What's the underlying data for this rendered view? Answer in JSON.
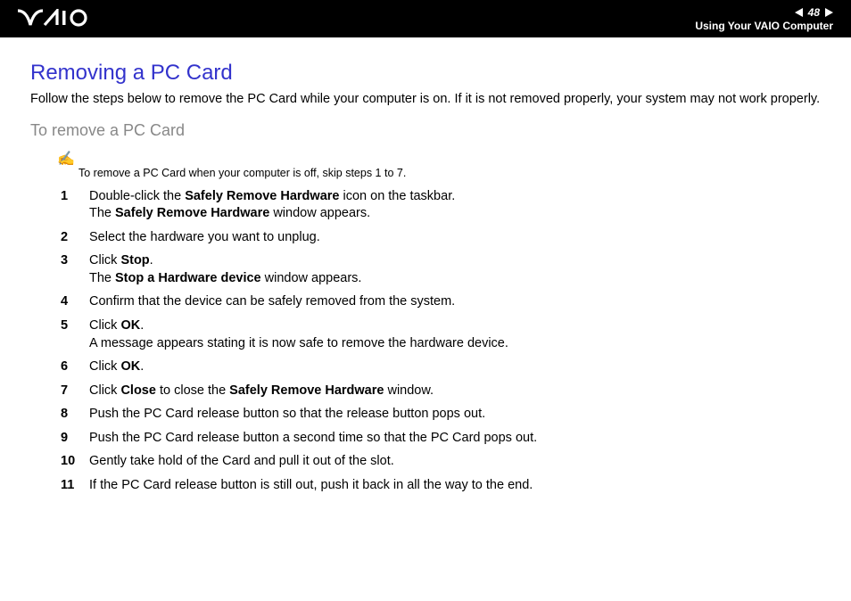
{
  "header": {
    "page_number": "48",
    "section": "Using Your VAIO Computer"
  },
  "title": "Removing a PC Card",
  "intro": "Follow the steps below to remove the PC Card while your computer is on. If it is not removed properly, your system may not work properly.",
  "subtitle": "To remove a PC Card",
  "note_icon": "✍",
  "note": "To remove a PC Card when your computer is off, skip steps 1 to 7.",
  "steps": [
    {
      "lines": [
        [
          {
            "t": "Double-click the "
          },
          {
            "t": "Safely Remove Hardware",
            "b": true
          },
          {
            "t": " icon on the taskbar."
          }
        ],
        [
          {
            "t": "The "
          },
          {
            "t": "Safely Remove Hardware",
            "b": true
          },
          {
            "t": " window appears."
          }
        ]
      ]
    },
    {
      "lines": [
        [
          {
            "t": "Select the hardware you want to unplug."
          }
        ]
      ]
    },
    {
      "lines": [
        [
          {
            "t": "Click "
          },
          {
            "t": "Stop",
            "b": true
          },
          {
            "t": "."
          }
        ],
        [
          {
            "t": "The "
          },
          {
            "t": "Stop a Hardware device",
            "b": true
          },
          {
            "t": " window appears."
          }
        ]
      ]
    },
    {
      "lines": [
        [
          {
            "t": "Confirm that the device can be safely removed from the system."
          }
        ]
      ]
    },
    {
      "lines": [
        [
          {
            "t": "Click "
          },
          {
            "t": "OK",
            "b": true
          },
          {
            "t": "."
          }
        ],
        [
          {
            "t": "A message appears stating it is now safe to remove the hardware device."
          }
        ]
      ]
    },
    {
      "lines": [
        [
          {
            "t": "Click "
          },
          {
            "t": "OK",
            "b": true
          },
          {
            "t": "."
          }
        ]
      ]
    },
    {
      "lines": [
        [
          {
            "t": "Click "
          },
          {
            "t": "Close",
            "b": true
          },
          {
            "t": " to close the "
          },
          {
            "t": "Safely Remove Hardware",
            "b": true
          },
          {
            "t": " window."
          }
        ]
      ]
    },
    {
      "lines": [
        [
          {
            "t": "Push the PC Card release button so that the release button pops out."
          }
        ]
      ]
    },
    {
      "lines": [
        [
          {
            "t": "Push the PC Card release button a second time so that the PC Card pops out."
          }
        ]
      ]
    },
    {
      "lines": [
        [
          {
            "t": "Gently take hold of the Card and pull it out of the slot."
          }
        ]
      ]
    },
    {
      "lines": [
        [
          {
            "t": "If the PC Card release button is still out, push it back in all the way to the end."
          }
        ]
      ]
    }
  ]
}
